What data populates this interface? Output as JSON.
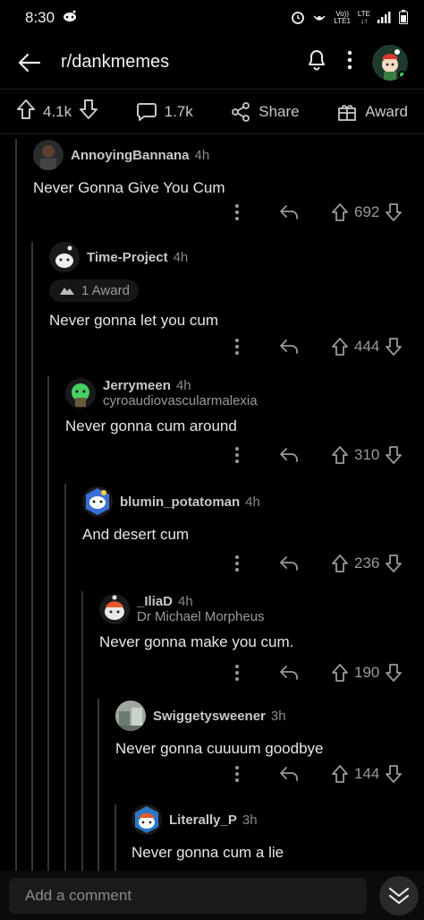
{
  "status_bar": {
    "time": "8:30",
    "network_top": "Vo))",
    "network_bottom": "LTE1",
    "lte_top": "LTE",
    "lte_bottom": "↓↑"
  },
  "header": {
    "title": "r/dankmemes"
  },
  "post_bar": {
    "upvotes": "4.1k",
    "comments": "1.7k",
    "share_label": "Share",
    "award_label": "Award"
  },
  "comments": [
    {
      "user": "AnnoyingBannana",
      "age": "4h",
      "flair": "",
      "award": "",
      "body": "Never Gonna Give You Cum",
      "score": "692"
    },
    {
      "user": "Time-Project",
      "age": "4h",
      "flair": "",
      "award": "1 Award",
      "body": "Never gonna let you cum",
      "score": "444"
    },
    {
      "user": "Jerrymeen",
      "age": "4h",
      "flair": "cyroaudiovascularmalexia",
      "award": "",
      "body": "Never gonna cum around",
      "score": "310"
    },
    {
      "user": "blumin_potatoman",
      "age": "4h",
      "flair": "",
      "award": "",
      "body": "And desert cum",
      "score": "236"
    },
    {
      "user": "_IliaD",
      "age": "4h",
      "flair": "Dr Michael Morpheus",
      "award": "",
      "body": "Never gonna make you cum.",
      "score": "190"
    },
    {
      "user": "Swiggetysweener",
      "age": "3h",
      "flair": "",
      "award": "",
      "body": "Never gonna cuuuum goodbye",
      "score": "144"
    },
    {
      "user": "Literally_P",
      "age": "3h",
      "flair": "",
      "award": "",
      "body": "Never gonna cum a lie",
      "score": ""
    }
  ],
  "bottom_bar": {
    "add_comment_placeholder": "Add a comment"
  },
  "colors": {
    "background": "#000000",
    "thread_line": "#343536",
    "text": "#e6e6e6",
    "muted": "#9a9a9a"
  }
}
